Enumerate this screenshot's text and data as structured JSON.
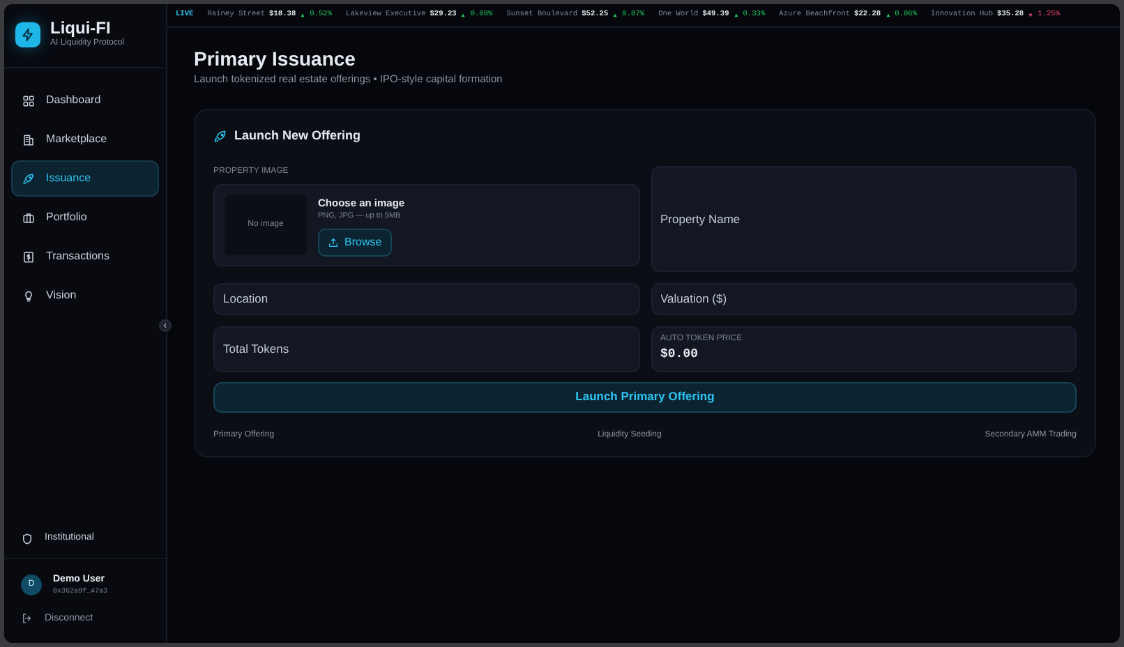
{
  "brand": {
    "name": "Liqui-FI",
    "tagline": "AI Liquidity Protocol"
  },
  "nav": [
    {
      "label": "Dashboard",
      "selected": false
    },
    {
      "label": "Marketplace",
      "selected": false
    },
    {
      "label": "Issuance",
      "selected": true
    },
    {
      "label": "Portfolio",
      "selected": false
    },
    {
      "label": "Transactions",
      "selected": false
    },
    {
      "label": "Vision",
      "selected": false
    }
  ],
  "institutional": "Institutional",
  "user": {
    "initial": "D",
    "name": "Demo User",
    "address": "0x362a9f…47a3"
  },
  "disconnect": "Disconnect",
  "ticker": {
    "live": "LIVE",
    "items": [
      {
        "name": "Rainey Street",
        "price": "$18.38",
        "change": "0.52%",
        "kind": "up"
      },
      {
        "name": "Lakeview Executive",
        "price": "$29.23",
        "change": "0.08%",
        "kind": "up"
      },
      {
        "name": "Sunset Boulevard",
        "price": "$52.25",
        "change": "0.07%",
        "kind": "up"
      },
      {
        "name": "One World",
        "price": "$49.39",
        "change": "0.33%",
        "kind": "up"
      },
      {
        "name": "Azure Beachfront",
        "price": "$22.28",
        "change": "0.06%",
        "kind": "up"
      },
      {
        "name": "Innovation Hub",
        "price": "$35.28",
        "change": "1.25%",
        "kind": "down"
      }
    ]
  },
  "page": {
    "title": "Primary Issuance",
    "subtitle": "Launch tokenized real estate offerings • IPO-style capital formation"
  },
  "form": {
    "title": "Launch New Offering",
    "image_label": "PROPERTY IMAGE",
    "no_image": "No image",
    "choose": "Choose an image",
    "formats": "PNG, JPG — up to 5MB",
    "browse": "Browse",
    "property_name": {
      "placeholder": "Property Name"
    },
    "location": {
      "placeholder": "Location"
    },
    "valuation": {
      "placeholder": "Valuation ($)"
    },
    "total_tokens": {
      "placeholder": "Total Tokens"
    },
    "auto_price": {
      "label": "AUTO TOKEN PRICE",
      "value": "$0.00"
    },
    "submit": "Launch Primary Offering",
    "steps": [
      "Primary Offering",
      "Liquidity Seeding",
      "Secondary AMM Trading"
    ]
  }
}
